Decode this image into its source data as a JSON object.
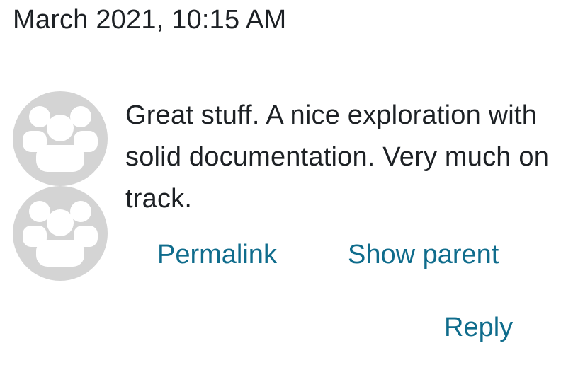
{
  "post": {
    "timestamp": "March 2021, 10:15 AM",
    "message": "Great stuff. A nice exploration with solid documentation. Very much on track.",
    "avatars": [
      {
        "icon": "users-icon"
      },
      {
        "icon": "users-icon"
      }
    ],
    "actions": {
      "permalink_label": "Permalink",
      "show_parent_label": "Show parent",
      "reply_label": "Reply"
    }
  },
  "colors": {
    "text": "#1d2125",
    "link": "#0f6c8c",
    "avatar_bg": "#d4d4d4",
    "avatar_fg": "#ffffff"
  }
}
